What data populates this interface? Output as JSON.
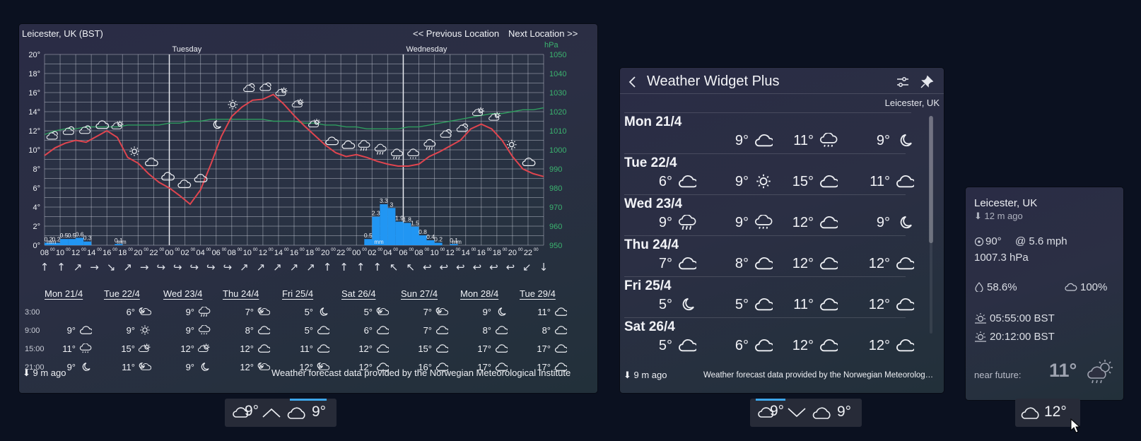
{
  "main": {
    "location": "Leicester, UK (BST)",
    "prev_label": "<< Previous Location",
    "next_label": "Next Location >>",
    "day_markers": [
      "Tuesday",
      "Wednesday"
    ],
    "hpa_label": "hPa",
    "footer_updated": "⬇ 9 m ago",
    "footer_credit": "Weather forecast data provided by the Norwegian Meteorological Institute",
    "table": {
      "days": [
        "Mon 21/4",
        "Tue 22/4",
        "Wed 23/4",
        "Thu 24/4",
        "Fri 25/4",
        "Sat 26/4",
        "Sun 27/4",
        "Mon 28/4",
        "Tue 29/4"
      ],
      "rows": [
        {
          "label": "3:00",
          "cells": [
            [
              "",
              ""
            ],
            [
              "6°",
              "partly-cloudy-night"
            ],
            [
              "9°",
              "rain"
            ],
            [
              "7°",
              "partly-cloudy-night"
            ],
            [
              "5°",
              "moon"
            ],
            [
              "5°",
              "partly-cloudy-night"
            ],
            [
              "7°",
              "partly-cloudy-night"
            ],
            [
              "9°",
              "moon"
            ],
            [
              "11°",
              "cloud"
            ]
          ]
        },
        {
          "label": "9:00",
          "cells": [
            [
              "9°",
              "cloud"
            ],
            [
              "9°",
              "sun"
            ],
            [
              "9°",
              "light-rain"
            ],
            [
              "8°",
              "cloud"
            ],
            [
              "5°",
              "cloud"
            ],
            [
              "6°",
              "cloud"
            ],
            [
              "7°",
              "cloud"
            ],
            [
              "8°",
              "cloud"
            ],
            [
              "8°",
              "cloud"
            ]
          ]
        },
        {
          "label": "15:00",
          "cells": [
            [
              "11°",
              "light-rain"
            ],
            [
              "15°",
              "partly-sunny"
            ],
            [
              "12°",
              "partly-sunny"
            ],
            [
              "12°",
              "cloud"
            ],
            [
              "11°",
              "cloud"
            ],
            [
              "12°",
              "cloud"
            ],
            [
              "15°",
              "cloud"
            ],
            [
              "17°",
              "cloud"
            ],
            [
              "17°",
              "cloud"
            ]
          ]
        },
        {
          "label": "21:00",
          "cells": [
            [
              "9°",
              "moon"
            ],
            [
              "11°",
              "partly-cloudy-night"
            ],
            [
              "9°",
              "moon"
            ],
            [
              "12°",
              "partly-cloudy-night"
            ],
            [
              "12°",
              "partly-cloudy-night"
            ],
            [
              "12°",
              "cloud"
            ],
            [
              "16°",
              "cloud"
            ],
            [
              "17°",
              "cloud"
            ],
            [
              "17°",
              "cloud"
            ]
          ]
        }
      ]
    }
  },
  "chart_data": {
    "type": "line",
    "x_tick_labels": [
      "08",
      "10",
      "12",
      "14",
      "16",
      "18",
      "20",
      "22",
      "00",
      "02",
      "04",
      "06",
      "08",
      "10",
      "12",
      "14",
      "16",
      "18",
      "20",
      "22",
      "00",
      "02",
      "04",
      "06",
      "08",
      "10",
      "12",
      "14",
      "16",
      "18",
      "20",
      "22"
    ],
    "y_left": {
      "unit": "°",
      "ticks": [
        "0°",
        "2°",
        "4°",
        "6°",
        "8°",
        "10°",
        "12°",
        "14°",
        "16°",
        "18°",
        "20°"
      ],
      "range": [
        0,
        20
      ]
    },
    "y_right": {
      "label": "hPa",
      "ticks": [
        "950",
        "960",
        "970",
        "980",
        "990",
        "1000",
        "1010",
        "1020",
        "1030",
        "1040",
        "1050"
      ],
      "range": [
        950,
        1050
      ]
    },
    "grid": true,
    "series": [
      {
        "color": "#e0454f",
        "values": [
          9.4,
          10.2,
          10.7,
          11.0,
          10.8,
          11.4,
          12.0,
          11.3,
          9.2,
          8.6,
          7.5,
          6.6,
          6.0,
          5.2,
          4.3,
          5.8,
          8.5,
          11.4,
          13.5,
          14.5,
          15.2,
          15.3,
          15.8,
          14.8,
          13.6,
          12.5,
          11.5,
          10.5,
          9.7,
          9.3,
          9.5,
          9.2,
          8.8,
          8.5,
          8.3,
          8.3,
          8.5,
          9.3,
          9.8,
          10.4,
          11.0,
          12.2,
          12.7,
          12.2,
          11.0,
          9.3,
          8.0,
          7.5,
          7.2
        ]
      },
      {
        "color": "#2f9e5f",
        "values": [
          1008,
          1010,
          1011,
          1011,
          1012,
          1012,
          1012,
          1012,
          1013,
          1013,
          1013,
          1013,
          1014,
          1014,
          1015,
          1015,
          1016,
          1016,
          1016,
          1016,
          1016,
          1016,
          1015,
          1015,
          1015,
          1014,
          1014,
          1013,
          1013,
          1012,
          1012,
          1011,
          1011,
          1011,
          1011,
          1012,
          1012,
          1013,
          1014,
          1015,
          1016,
          1017,
          1018,
          1019,
          1019,
          1020,
          1021,
          1021,
          1022
        ]
      }
    ],
    "precipitation_mm": [
      {
        "hour": 0,
        "value": 0.2,
        "label": "0.2"
      },
      {
        "hour": 1,
        "value": 0.2,
        "label": "0.2"
      },
      {
        "hour": 2,
        "value": 0.5,
        "label": "0.5"
      },
      {
        "hour": 3,
        "value": 0.5,
        "label": "0.5"
      },
      {
        "hour": 4,
        "value": 0.6,
        "label": "0.6"
      },
      {
        "hour": 5,
        "value": 0.3,
        "label": "0.3"
      },
      {
        "hour": 9,
        "value": 0.1,
        "label": "0.1"
      },
      {
        "hour": 41,
        "value": 0.5,
        "label": "0.5"
      },
      {
        "hour": 42,
        "value": 2.3,
        "label": "2.3"
      },
      {
        "hour": 43,
        "value": 3.3,
        "label": "3.3"
      },
      {
        "hour": 44,
        "value": 3.0,
        "label": "3"
      },
      {
        "hour": 45,
        "value": 1.9,
        "label": "1.9"
      },
      {
        "hour": 46,
        "value": 1.8,
        "label": "1.8"
      },
      {
        "hour": 47,
        "value": 1.5,
        "label": "1.5"
      },
      {
        "hour": 48,
        "value": 0.8,
        "label": "0.8"
      },
      {
        "hour": 49,
        "value": 0.4,
        "label": "0.4"
      },
      {
        "hour": 50,
        "value": 0.2,
        "label": "0.2"
      },
      {
        "hour": 52,
        "value": 0.1,
        "label": "0.1"
      }
    ],
    "precip_unit": "mm",
    "temperature_icons": [
      "partly-cloudy",
      "partly-cloudy",
      "partly-cloudy",
      "cloud",
      "partly-sunny",
      "sun",
      "cloud",
      "cloud",
      "cloud",
      "cloud",
      "moon",
      "sun",
      "partly-cloudy",
      "partly-cloudy",
      "partly-sunny",
      "partly-sunny",
      "partly-sunny",
      "cloud",
      "cloud",
      "rain",
      "rain",
      "rain",
      "light-rain",
      "rain",
      "partly-cloudy",
      "partly-cloudy",
      "partly-sunny",
      "partly-sunny",
      "sun",
      "cloud"
    ],
    "wind_arrows": [
      "↑",
      "↑",
      "↗",
      "→",
      "↘",
      "↗",
      "→",
      "↪",
      "↪",
      "↪",
      "↪",
      "↪",
      "↗",
      "↗",
      "↗",
      "↗",
      "↗",
      "↑",
      "↑",
      "↑",
      "↑",
      "↖",
      "↖",
      "↩",
      "↩",
      "↩",
      "↩",
      "↩",
      "↩",
      "↙",
      "↓"
    ]
  },
  "widget": {
    "back_icon": "chevron-left-icon",
    "title": "Weather Widget Plus",
    "location": "Leicester, UK",
    "days": [
      {
        "name": "Mon 21/4",
        "slots": [
          [
            "",
            ""
          ],
          [
            "9°",
            "cloud"
          ],
          [
            "11°",
            "light-rain"
          ],
          [
            "9°",
            "moon"
          ]
        ]
      },
      {
        "name": "Tue 22/4",
        "slots": [
          [
            "6°",
            "cloud"
          ],
          [
            "9°",
            "sun"
          ],
          [
            "15°",
            "cloud"
          ],
          [
            "11°",
            "cloud"
          ]
        ]
      },
      {
        "name": "Wed 23/4",
        "slots": [
          [
            "9°",
            "rain"
          ],
          [
            "9°",
            "light-rain"
          ],
          [
            "12°",
            "cloud"
          ],
          [
            "9°",
            "moon"
          ]
        ]
      },
      {
        "name": "Thu 24/4",
        "slots": [
          [
            "7°",
            "cloud"
          ],
          [
            "8°",
            "cloud"
          ],
          [
            "12°",
            "cloud"
          ],
          [
            "12°",
            "cloud"
          ]
        ]
      },
      {
        "name": "Fri 25/4",
        "slots": [
          [
            "5°",
            "moon"
          ],
          [
            "5°",
            "cloud"
          ],
          [
            "11°",
            "cloud"
          ],
          [
            "12°",
            "cloud"
          ]
        ]
      },
      {
        "name": "Sat 26/4",
        "slots": [
          [
            "5°",
            "cloud"
          ],
          [
            "6°",
            "cloud"
          ],
          [
            "12°",
            "cloud"
          ],
          [
            "12°",
            "cloud"
          ]
        ]
      }
    ],
    "footer_updated": "⬇ 9 m ago",
    "footer_credit": "Weather forecast data provided by the Norwegian Meteorolog…"
  },
  "compact": {
    "location": "Leicester, UK",
    "updated": "⬇ 12 m ago",
    "wind_dir": "90°",
    "wind_speed": "@ 5.6 mph",
    "pressure": "1007.3 hPa",
    "humidity": "58.6%",
    "cloud_cover": "100%",
    "sunrise": "05:55:00 BST",
    "sunset": "20:12:00 BST",
    "near_future_label": "near future:",
    "near_future_temp": "11°"
  },
  "chips": [
    {
      "temp_a": "9°",
      "temp_b": "9°"
    },
    {
      "temp_a": "9°",
      "temp_b": "9°"
    },
    {
      "temp_a": "12°"
    }
  ],
  "colors": {
    "accent": "#3da5e8",
    "temperature": "#e0454f",
    "pressure": "#2f9e5f",
    "precip": "#2196f3"
  }
}
